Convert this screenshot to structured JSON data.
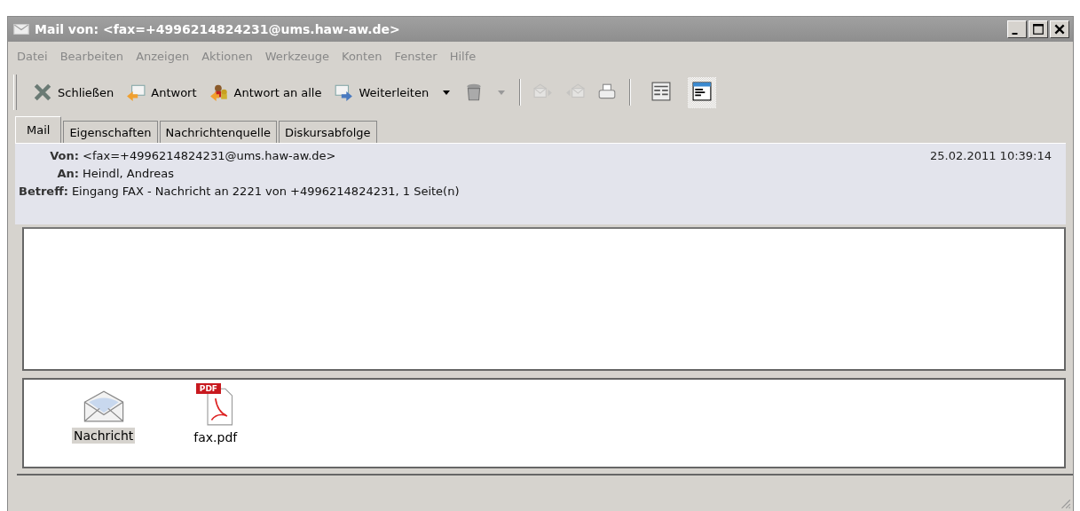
{
  "window": {
    "title": "Mail von: <fax=+4996214824231@ums.haw-aw.de>"
  },
  "menu": [
    "Datei",
    "Bearbeiten",
    "Anzeigen",
    "Aktionen",
    "Werkzeuge",
    "Konten",
    "Fenster",
    "Hilfe"
  ],
  "toolbar": [
    {
      "kind": "close",
      "label": "Schließen",
      "disabled": false
    },
    {
      "kind": "reply",
      "label": "Antwort",
      "disabled": false
    },
    {
      "kind": "replyall",
      "label": "Antwort an alle",
      "disabled": false
    },
    {
      "kind": "forward",
      "label": "Weiterleiten",
      "disabled": false,
      "dropdown": true
    },
    {
      "kind": "trash",
      "disabled": false,
      "dropdown": true
    },
    {
      "kind": "separator"
    },
    {
      "kind": "next",
      "disabled": true
    },
    {
      "kind": "previous",
      "disabled": true
    },
    {
      "kind": "print",
      "disabled": false
    },
    {
      "kind": "separator"
    }
  ],
  "layout_buttons": [
    {
      "kind": "classic",
      "selected": false
    },
    {
      "kind": "preview",
      "selected": true
    }
  ],
  "tabs": [
    {
      "label": "Mail",
      "selected": true
    },
    {
      "label": "Eigenschaften",
      "selected": false
    },
    {
      "label": "Nachrichtenquelle",
      "selected": false
    },
    {
      "label": "Diskursabfolge",
      "selected": false
    }
  ],
  "header": {
    "fields": [
      {
        "label": "Von:",
        "value": "<fax=+4996214824231@ums.haw-aw.de>"
      },
      {
        "label": "An:",
        "value": "Heindl, Andreas"
      },
      {
        "label": "Betreff:",
        "value": "Eingang FAX - Nachricht an 2221 von +4996214824231, 1 Seite(n)"
      }
    ],
    "date": "25.02.2011 10:39:14"
  },
  "attachments": [
    {
      "kind": "message",
      "name": "Nachricht",
      "selected": true
    },
    {
      "kind": "pdf",
      "name": "fax.pdf",
      "badge": "PDF",
      "selected": false
    }
  ]
}
